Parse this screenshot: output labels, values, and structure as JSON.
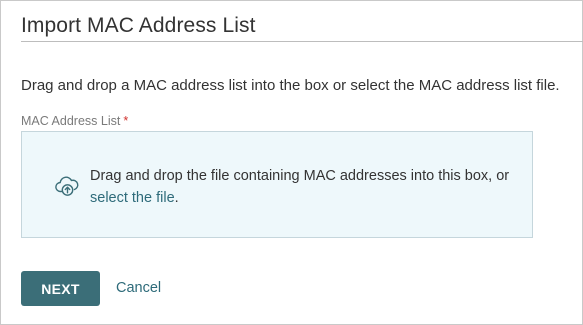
{
  "dialog": {
    "title": "Import MAC Address List",
    "instructions": "Drag and drop a MAC address list into the box or select the MAC address list file."
  },
  "field": {
    "label": "MAC Address List",
    "required_marker": "*"
  },
  "dropzone": {
    "icon": "cloud-upload-icon",
    "text": "Drag and drop the file containing MAC addresses into this box, or",
    "link_text": "select the file",
    "trailing": "."
  },
  "actions": {
    "next_label": "NEXT",
    "cancel_label": "Cancel"
  },
  "colors": {
    "primary_button": "#3b6e78",
    "link": "#2e6b7a",
    "dropzone_bg": "#eef8fb",
    "required": "#d0312d"
  }
}
